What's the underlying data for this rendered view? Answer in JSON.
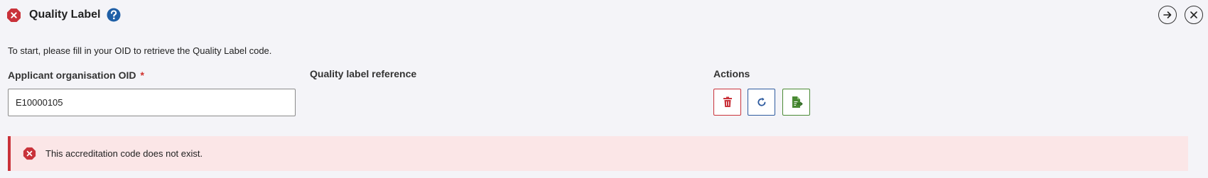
{
  "header": {
    "title": "Quality Label",
    "status_icon": "error-circle-icon",
    "help_icon": "help-circle-icon",
    "forward_icon": "arrow-right-circle-icon",
    "close_icon": "close-circle-icon"
  },
  "intro_text": "To start, please fill in your OID to retrieve the Quality Label code.",
  "form": {
    "oid_label": "Applicant organisation OID",
    "required_marker": "*",
    "oid_value": "E10000105",
    "reference_label": "Quality label reference"
  },
  "actions": {
    "label": "Actions",
    "buttons": [
      {
        "name": "delete",
        "icon": "trash-icon",
        "color": "#c9323a"
      },
      {
        "name": "refresh",
        "icon": "refresh-icon",
        "color": "#2d5a9e"
      },
      {
        "name": "export",
        "icon": "document-export-icon",
        "color": "#4a8a34"
      }
    ]
  },
  "alert": {
    "icon": "error-circle-icon",
    "message": "This accreditation code does not exist.",
    "accent_color": "#c9323a",
    "background_color": "#fbe6e7"
  }
}
